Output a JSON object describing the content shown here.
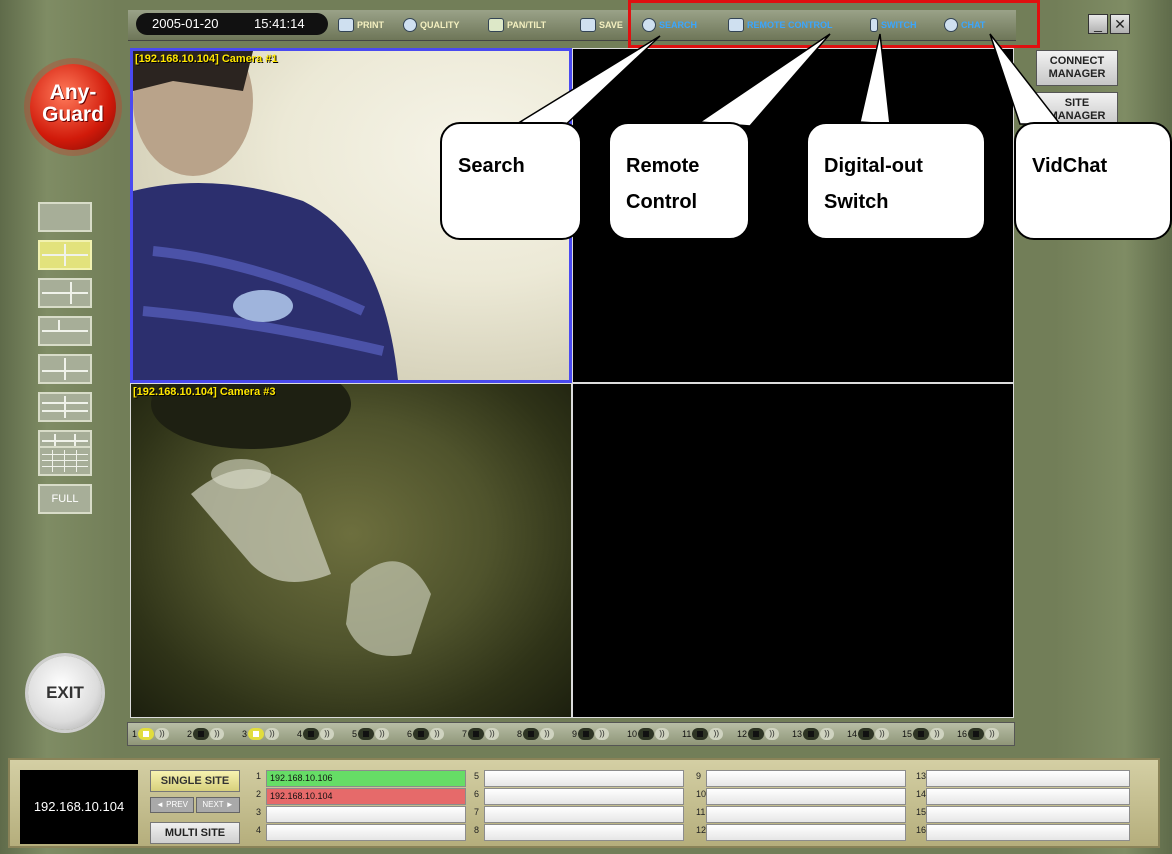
{
  "topbar": {
    "date": "2005-01-20",
    "time": "15:41:14",
    "print": "PRINT",
    "quality": "QUALITY",
    "pantilt": "PAN/TILT",
    "save": "SAVE",
    "search": "SEARCH",
    "remote": "REMOTE CONTROL",
    "switch": "SWITCH",
    "chat": "CHAT"
  },
  "logo": {
    "line1": "Any-",
    "line2": "Guard"
  },
  "left": {
    "full": "FULL",
    "exit": "EXIT"
  },
  "right": {
    "connect": "CONNECT MANAGER",
    "site": "SITE MANAGER"
  },
  "cameras": {
    "cam1": "[192.168.10.104] Camera #1",
    "cam3": "[192.168.10.104] Camera #3"
  },
  "channels": [
    "1",
    "2",
    "3",
    "4",
    "5",
    "6",
    "7",
    "8",
    "9",
    "10",
    "11",
    "12",
    "13",
    "14",
    "15",
    "16"
  ],
  "bottom": {
    "current_ip": "192.168.10.104",
    "single_site": "SINGLE SITE",
    "prev": "◄ PREV",
    "next": "NEXT ►",
    "multi_site": "MULTI SITE",
    "sites": [
      {
        "n": "1",
        "v": "192.168.10.106"
      },
      {
        "n": "2",
        "v": "192.168.10.104"
      },
      {
        "n": "3",
        "v": ""
      },
      {
        "n": "4",
        "v": ""
      },
      {
        "n": "5",
        "v": ""
      },
      {
        "n": "6",
        "v": ""
      },
      {
        "n": "7",
        "v": ""
      },
      {
        "n": "8",
        "v": ""
      },
      {
        "n": "9",
        "v": ""
      },
      {
        "n": "10",
        "v": ""
      },
      {
        "n": "11",
        "v": ""
      },
      {
        "n": "12",
        "v": ""
      },
      {
        "n": "13",
        "v": ""
      },
      {
        "n": "14",
        "v": ""
      },
      {
        "n": "15",
        "v": ""
      },
      {
        "n": "16",
        "v": ""
      }
    ]
  },
  "callouts": {
    "search": "Search",
    "remote1": "Remote",
    "remote2": "Control",
    "dout1": "Digital-out",
    "dout2": "Switch",
    "vidchat": "VidChat"
  },
  "colors": {
    "highlight_box": "#e01010",
    "selected_cam_border": "#4a4af0",
    "cam_label": "#ffe600",
    "site_online": "#66dd66",
    "site_active": "#e66a6a"
  }
}
